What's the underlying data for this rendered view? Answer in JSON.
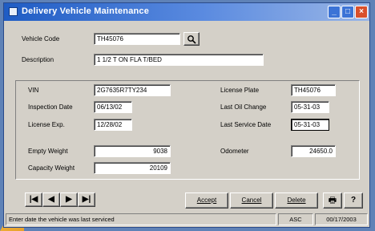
{
  "window": {
    "title": "Delivery Vehicle Maintenance",
    "controls": {
      "minimize": "_",
      "maximize": "□",
      "close": "×"
    }
  },
  "header_fields": {
    "vehicle_code": {
      "label": "Vehicle Code",
      "value": "TH45076"
    },
    "description": {
      "label": "Description",
      "value": "1 1/2 T ON FLA T/BED"
    }
  },
  "details": {
    "vin": {
      "label": "VIN",
      "value": "2G7635R7TY234"
    },
    "inspection_date": {
      "label": "Inspection Date",
      "value": "06/13/02"
    },
    "license_exp": {
      "label": "License Exp.",
      "value": "12/28/02"
    },
    "license_plate": {
      "label": "License Plate",
      "value": "TH45076"
    },
    "last_oil_change": {
      "label": "Last Oil Change",
      "value": "05-31-03"
    },
    "last_service_date": {
      "label": "Last Service Date",
      "value": "05-31-03"
    },
    "empty_weight": {
      "label": "Empty Weight",
      "value": "9038"
    },
    "capacity_weight": {
      "label": "Capacity Weight",
      "value": "20109"
    },
    "odometer": {
      "label": "Odometer",
      "value": "24650.0"
    }
  },
  "nav": {
    "first": "|◀",
    "prev": "◀",
    "next": "▶",
    "last": "▶|"
  },
  "actions": {
    "accept": "Accept",
    "cancel": "Cancel",
    "delete": "Delete",
    "print": "🖶",
    "help": "?"
  },
  "search_icon": "magnifier-icon",
  "status": {
    "message": "Enter date the vehicle was last serviced",
    "mode": "ASC",
    "date": "00/17/2003"
  },
  "colors": {
    "titlebar": "#1f5cc4",
    "window": "#d4d0c8",
    "background": "#5f82b7",
    "close": "#d9502c"
  }
}
